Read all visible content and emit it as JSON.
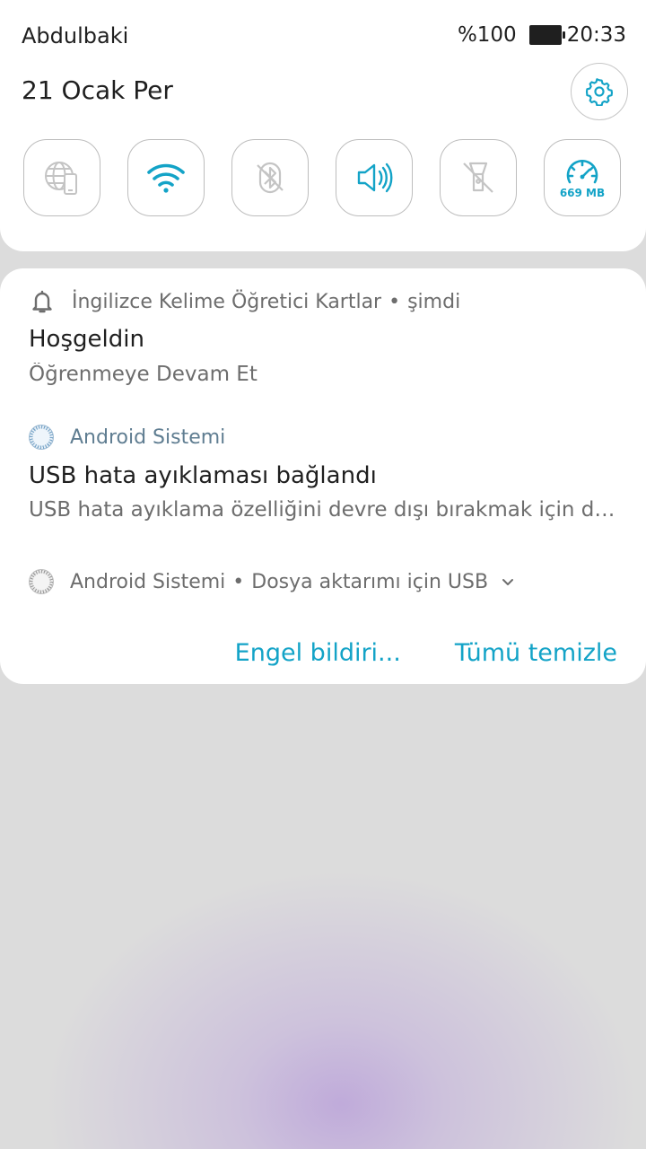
{
  "status_bar": {
    "user": "Abdulbaki",
    "battery": "%100",
    "time": "20:33"
  },
  "quick_settings": {
    "date": "21 Ocak Per",
    "tiles": [
      {
        "name": "mobile-data",
        "icon": "globe-phone-icon",
        "active": false
      },
      {
        "name": "wifi",
        "icon": "wifi-icon",
        "active": true
      },
      {
        "name": "bluetooth",
        "icon": "bluetooth-off-icon",
        "active": false
      },
      {
        "name": "sound",
        "icon": "speaker-icon",
        "active": true
      },
      {
        "name": "flashlight",
        "icon": "flashlight-off-icon",
        "active": false
      },
      {
        "name": "data-usage",
        "icon": "speedometer-icon",
        "active": true,
        "label": "669 MB"
      }
    ],
    "accent_color": "#13a3c7"
  },
  "notifications": [
    {
      "app": "İngilizce Kelime Öğretici Kartlar",
      "time": "şimdi",
      "icon": "bell-icon",
      "title": "Hoşgeldin",
      "text": "Öğrenmeye Devam Et"
    },
    {
      "app": "Android Sistemi",
      "icon": "android-system-icon",
      "title": "USB hata ayıklaması bağlandı",
      "text": "USB hata ayıklama özelliğini devre dışı bırakmak için dok.."
    },
    {
      "app": "Android Sistemi",
      "icon": "android-system-icon",
      "summary": "Dosya aktarımı için USB"
    }
  ],
  "actions": {
    "block": "Engel bildiri...",
    "clear_all": "Tümü temizle"
  }
}
